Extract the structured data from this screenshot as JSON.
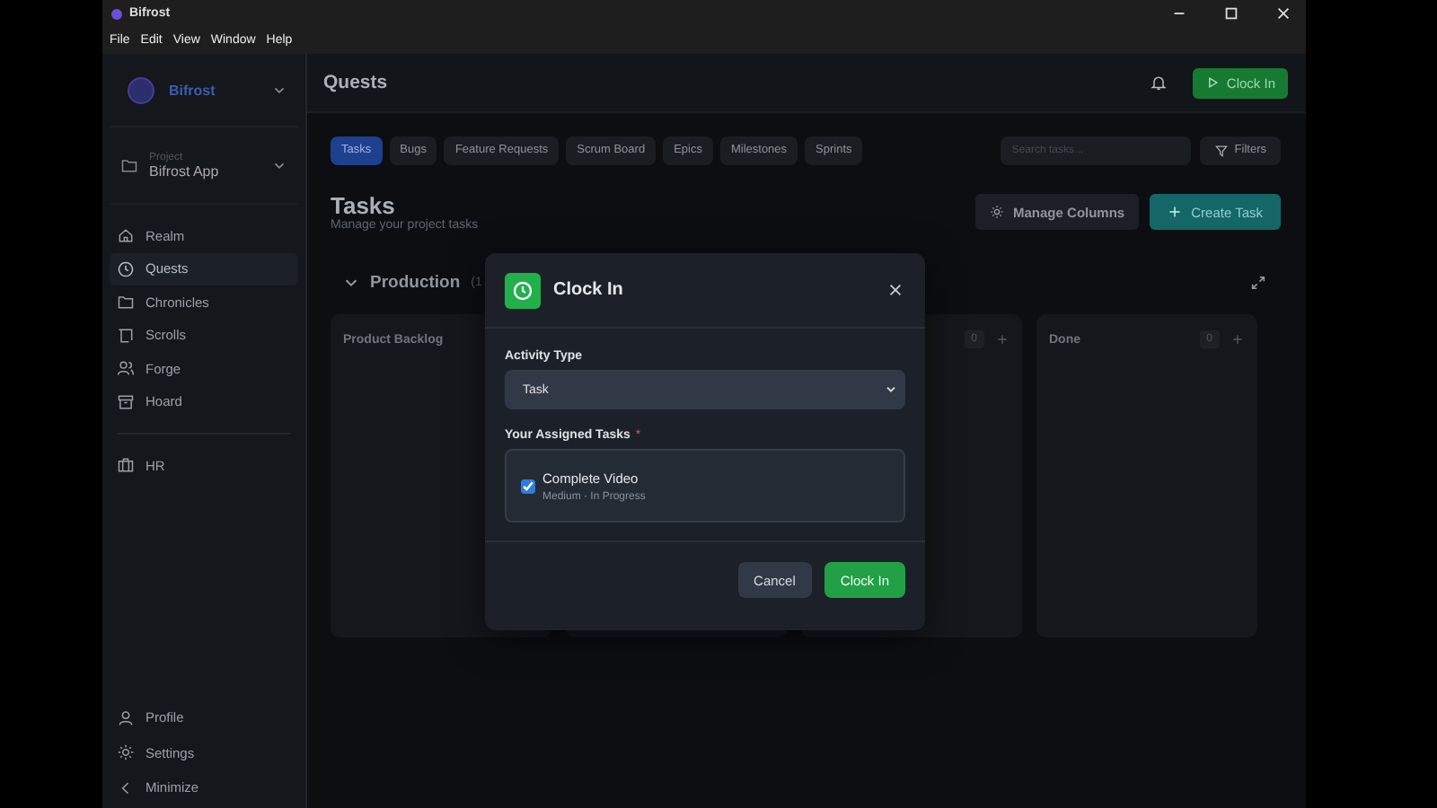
{
  "window": {
    "title": "Bifrost",
    "menu": [
      "File",
      "Edit",
      "View",
      "Window",
      "Help"
    ]
  },
  "sidebar": {
    "workspace": "Bifrost",
    "project_label": "Project",
    "project": "Bifrost App",
    "items": [
      {
        "label": "Realm",
        "selected": false
      },
      {
        "label": "Quests",
        "selected": true
      },
      {
        "label": "Chronicles",
        "selected": false
      },
      {
        "label": "Scrolls",
        "selected": false
      },
      {
        "label": "Forge",
        "selected": false
      },
      {
        "label": "Hoard",
        "selected": false
      }
    ],
    "extra_items": [
      {
        "label": "HR",
        "selected": false
      }
    ],
    "footer": [
      {
        "label": "Profile"
      },
      {
        "label": "Settings"
      },
      {
        "label": "Minimize"
      }
    ]
  },
  "header": {
    "title": "Quests",
    "clock_in": "Clock In"
  },
  "tabs": [
    {
      "label": "Tasks",
      "selected": true
    },
    {
      "label": "Bugs",
      "selected": false
    },
    {
      "label": "Feature Requests",
      "selected": false
    },
    {
      "label": "Scrum Board",
      "selected": false
    },
    {
      "label": "Epics",
      "selected": false
    },
    {
      "label": "Milestones",
      "selected": false
    },
    {
      "label": "Sprints",
      "selected": false
    }
  ],
  "search": {
    "placeholder": "Search tasks..."
  },
  "filters": "Filters",
  "page": {
    "title": "Tasks",
    "subtitle": "Manage your project tasks",
    "manage_columns": "Manage Columns",
    "create_task": "Create Task"
  },
  "board": {
    "group": "Production",
    "group_count": "(1",
    "expanded": true,
    "columns": [
      {
        "title": "Product Backlog"
      },
      {},
      {
        "count": "0"
      },
      {
        "title": "Done",
        "count": "0"
      }
    ]
  },
  "modal": {
    "title": "Clock In",
    "activity_label": "Activity Type",
    "activity_value": "Task",
    "tasks_label": "Your Assigned Tasks",
    "required_mark": "*",
    "tasks": [
      {
        "title": "Complete Video",
        "meta": "Medium · In Progress",
        "checked": true
      }
    ],
    "cancel": "Cancel",
    "confirm": "Clock In"
  }
}
